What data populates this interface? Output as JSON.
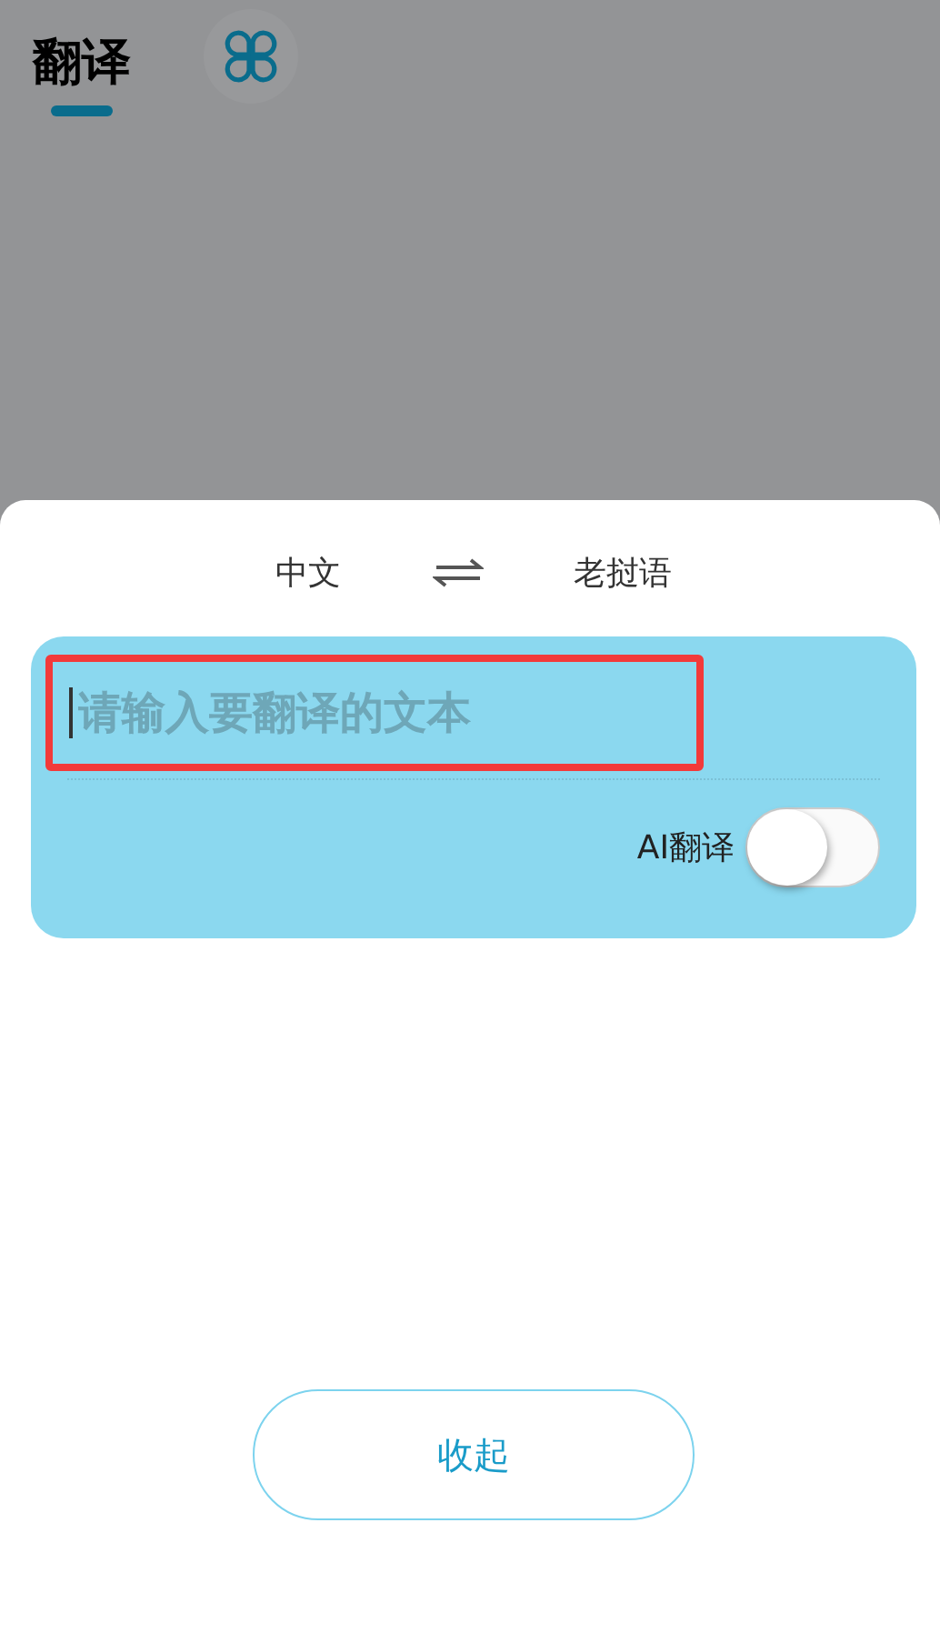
{
  "tabs": [
    {
      "kind": "text",
      "label": "翻译",
      "selected": true
    },
    {
      "kind": "icon",
      "selected": false
    }
  ],
  "languages": {
    "source": "中文",
    "target": "老挝语"
  },
  "input": {
    "placeholder": "请输入要翻译的文本",
    "highlighted": true
  },
  "ai_toggle": {
    "label": "AI翻译",
    "on": false
  },
  "collapse_button": "收起"
}
